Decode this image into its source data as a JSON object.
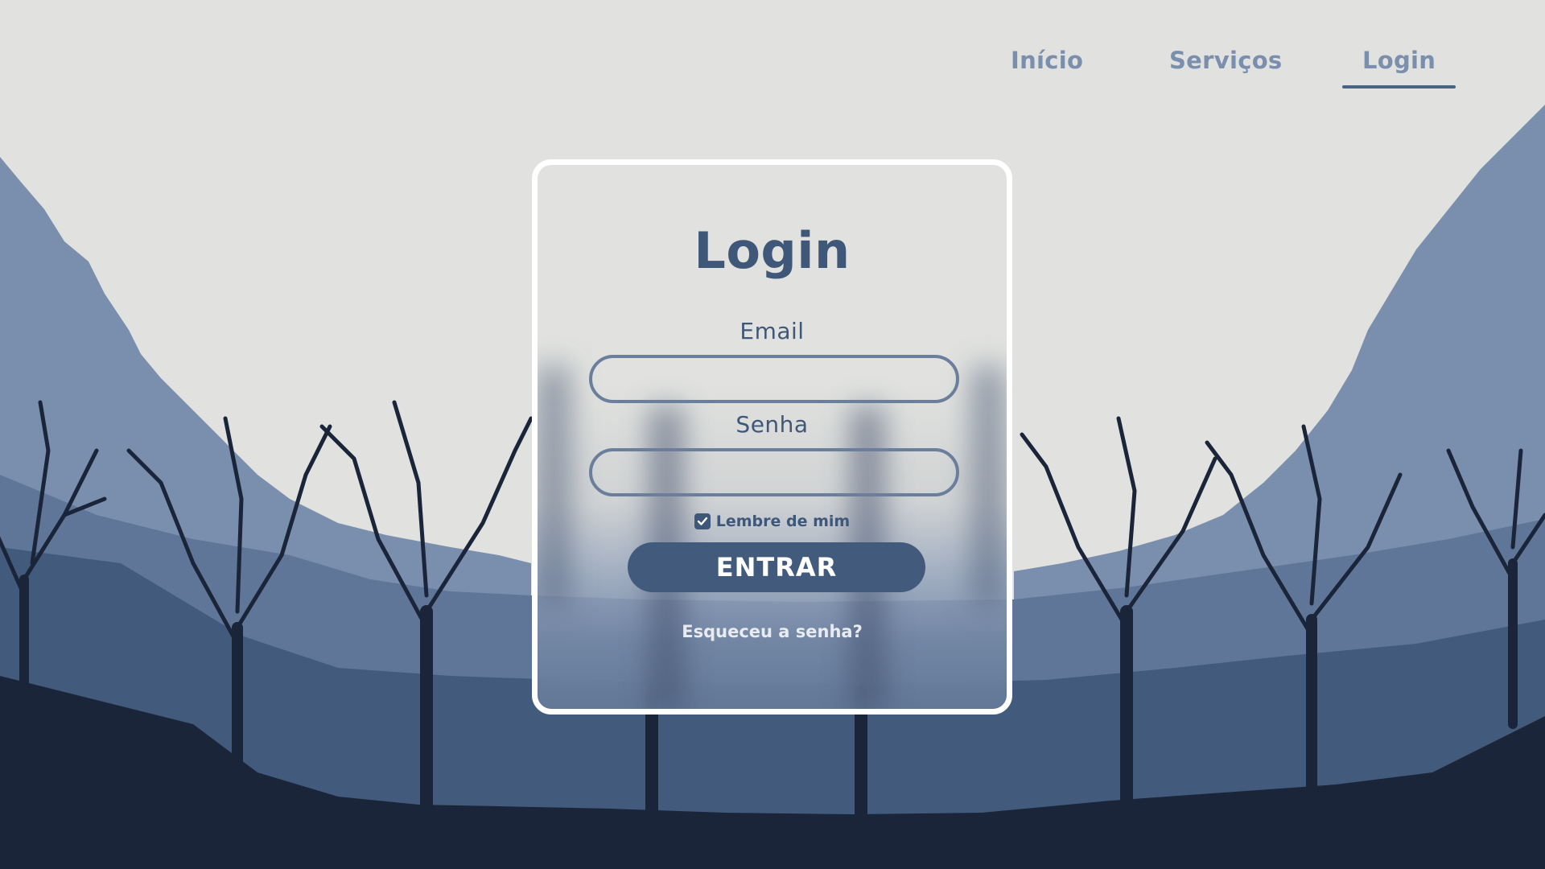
{
  "nav": {
    "items": [
      {
        "label": "Início"
      },
      {
        "label": "Serviços"
      },
      {
        "label": "Login"
      }
    ],
    "active": "Login"
  },
  "form": {
    "title": "Login",
    "email_label": "Email",
    "email_value": "",
    "password_label": "Senha",
    "password_value": "",
    "remember_label": "Lembre de mim",
    "remember_checked": true,
    "submit_label": "ENTRAR",
    "forgot_label": "Esqueceu a senha?"
  },
  "colors": {
    "background": "#e1e2df",
    "accent": "#425b7c",
    "nav_text": "#7a8fad",
    "mountain_light": "#7a8fad",
    "mountain_mid": "#425b7c",
    "ground_dark": "#1b253a"
  },
  "icons": {
    "checkbox": "check-icon"
  }
}
